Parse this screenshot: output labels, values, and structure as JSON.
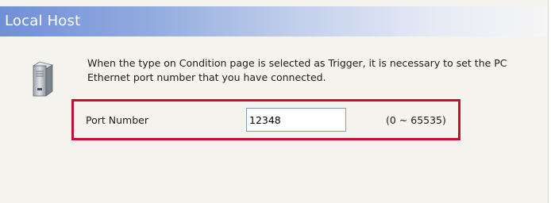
{
  "header": {
    "title": "Local Host"
  },
  "description": "When the type on Condition page is selected as Trigger, it is necessary to set the PC Ethernet port number that you have connected.",
  "port": {
    "label": "Port Number",
    "value": "12348",
    "range": "(0 ~ 65535)"
  },
  "icons": {
    "device": "computer-tower-icon"
  },
  "colors": {
    "header_gradient_start": "#6f8fd8",
    "header_gradient_end": "#f6f6f6",
    "highlight_border": "#c8102e",
    "panel_background": "#f4f3ee"
  }
}
